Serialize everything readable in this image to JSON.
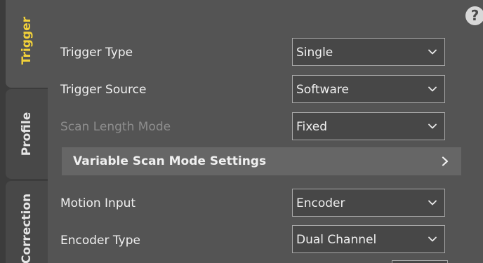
{
  "tabs": [
    {
      "label": "Trigger",
      "active": true
    },
    {
      "label": "Profile",
      "active": false
    },
    {
      "label": "Correction",
      "active": false
    }
  ],
  "help_icon": {
    "glyph": "?"
  },
  "fields": {
    "trigger_type": {
      "label": "Trigger Type",
      "value": "Single",
      "enabled": true
    },
    "trigger_source": {
      "label": "Trigger Source",
      "value": "Software",
      "enabled": true
    },
    "scan_length_mode": {
      "label": "Scan Length Mode",
      "value": "Fixed",
      "enabled": false
    },
    "motion_input": {
      "label": "Motion Input",
      "value": "Encoder",
      "enabled": true
    },
    "encoder_type": {
      "label": "Encoder Type",
      "value": "Dual Channel",
      "enabled": true
    }
  },
  "section": {
    "title": "Variable Scan Mode Settings"
  },
  "colors": {
    "background": "#545454",
    "tab_strip": "#3c3c3c",
    "active_tab_label": "#f3d23a",
    "section_bar": "#666666",
    "disabled_text": "#8e8e8e"
  }
}
